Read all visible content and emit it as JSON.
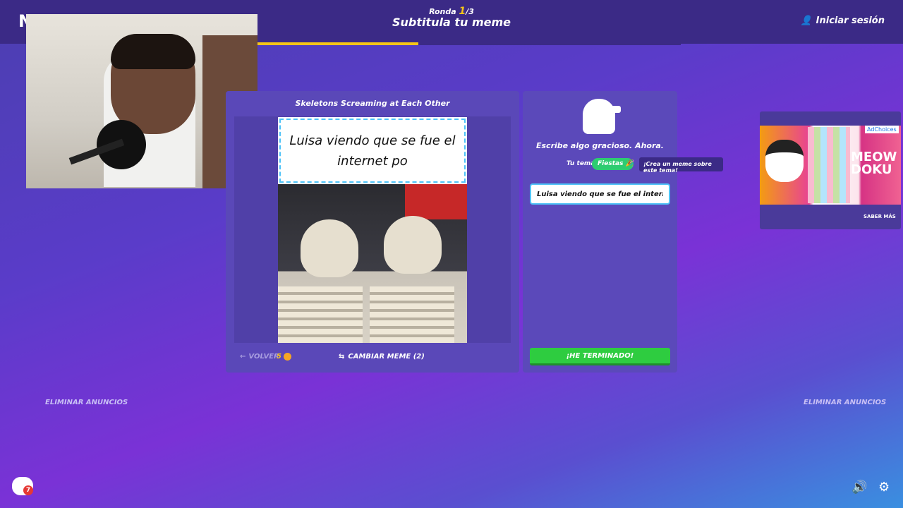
{
  "header": {
    "logo": "NM",
    "round_label": "Ronda",
    "round_current": "1",
    "round_total": "/3",
    "title": "Subtitula tu meme",
    "login_label": "Iniciar sesión",
    "progress_fraction": 0.38
  },
  "meme": {
    "title": "Skeletons Screaming at Each Other",
    "caption": "Luisa viendo que se fue el internet po",
    "back_label": "VOLVER",
    "coins": "5",
    "change_label": "CAMBIAR MEME (2)"
  },
  "write": {
    "prompt": "Escribe algo gracioso. Ahora.",
    "theme_label": "Tu tema:",
    "theme_value": "Fiestas",
    "theme_tip": "¡Crea un meme sobre este tema!",
    "input_value": "Luisa viendo que se fue el internet po",
    "done_label": "¡HE TERMINADO!"
  },
  "ad": {
    "choices": "AdChoices",
    "brand": "MEOW DOKU",
    "more_label": "SABER MÁS"
  },
  "footer": {
    "remove_ads_left": "ELIMINAR ANUNCIOS",
    "remove_ads_right": "ELIMINAR ANUNCIOS",
    "chat_badge": "7"
  },
  "colors": {
    "accent_yellow": "#f5c518",
    "done_green": "#2ecc40",
    "theme_green": "#2ecc71",
    "panel_purple": "#5a48b8"
  }
}
